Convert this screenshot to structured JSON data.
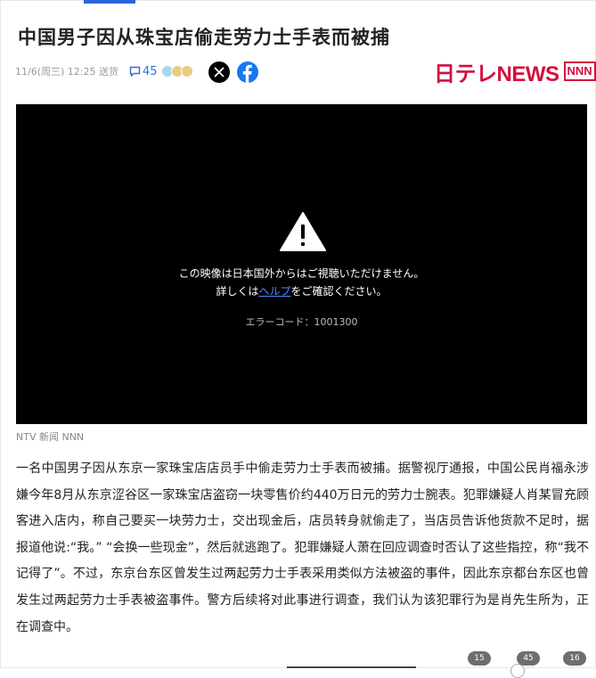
{
  "article": {
    "title": "中国男子因从珠宝店偷走劳力士手表而被捕",
    "date": "11/6(周三) 12:25 送货",
    "comment_count": "45",
    "caption": "NTV 新闻 NNN",
    "body": "一名中国男子因从东京一家珠宝店店员手中偷走劳力士手表而被捕。据警视厅通报，中国公民肖福永涉嫌今年8月从东京涩谷区一家珠宝店盗窃一块零售价约440万日元的劳力士腕表。犯罪嫌疑人肖某冒充顾客进入店内，称自己要买一块劳力士，交出现金后，店员转身就偷走了，当店员告诉他货款不足时，据报道他说:“我。” “会换一些现金”，然后就逃跑了。犯罪嫌疑人萧在回应调查时否认了这些指控，称“我不记得了”。不过，东京台东区曾发生过两起劳力士手表采用类似方法被盗的事件，因此东京都台东区也曾发生过两起劳力士手表被盗事件。警方后续将对此事进行调查，我们认为该犯罪行为是肖先生所为，正在调查中。"
  },
  "brand": {
    "name": "日テレNEWS",
    "badge": "NNN",
    "color": "#d30f3c"
  },
  "video": {
    "message_line1": "この映像は日本国外からはご視聴いただけません。",
    "message_line2_pre": "詳しくは",
    "help_link": "ヘルプ",
    "message_line2_post": "をご確認ください。",
    "error_code": "エラーコード：1001300"
  },
  "icons": {
    "comment": "comment-bubble-icon",
    "reactions": "reaction-emoji-icons",
    "share_x": "x-logo-icon",
    "share_facebook": "facebook-logo-icon",
    "warning": "warning-triangle-icon"
  },
  "bottom_badges": [
    "15",
    "45",
    "16"
  ],
  "colors": {
    "link": "#2f6fd6",
    "facebook": "#1877f2",
    "video_bg": "#000000"
  }
}
